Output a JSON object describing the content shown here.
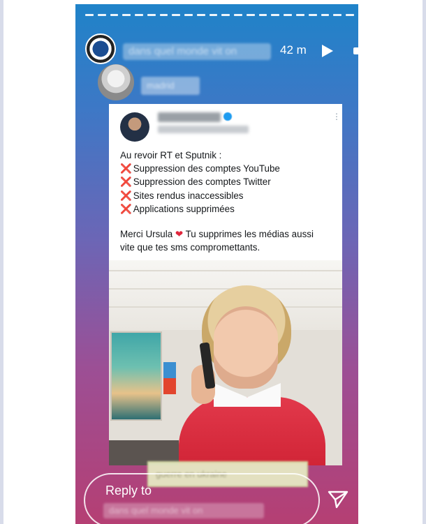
{
  "story": {
    "progress_segments": 22,
    "header": {
      "account_name": "dans quel monde vit on",
      "time": "42 m",
      "controls": {
        "play": "play-icon",
        "more": "more-icon"
      }
    },
    "reposted_from": {
      "account_name": "madrid"
    }
  },
  "tweet": {
    "author": "Alexis Poulin",
    "handle": "@Poulin2012 · 30 m",
    "lines": [
      "Au revoir RT et Sputnik :",
      "Suppression des comptes YouTube",
      "Suppression des comptes Twitter",
      "Sites rendus inaccessibles",
      "Applications supprimées"
    ],
    "closing": {
      "before_heart": "Merci Ursula",
      "after_heart": "Tu supprimes les médias aussi",
      "line2": "vite que tes sms compromettants."
    },
    "icons": {
      "bullet": "❌",
      "heart": "❤"
    }
  },
  "caption_sticker": {
    "text": "guerre en ukraine"
  },
  "reply": {
    "label": "Reply to",
    "recipient": "dans quel monde vit on"
  },
  "colors": {
    "gradient_top": "#1f83c9",
    "gradient_bottom": "#b53f73",
    "x_mark": "#e0263c",
    "verified": "#1d9bf0"
  }
}
